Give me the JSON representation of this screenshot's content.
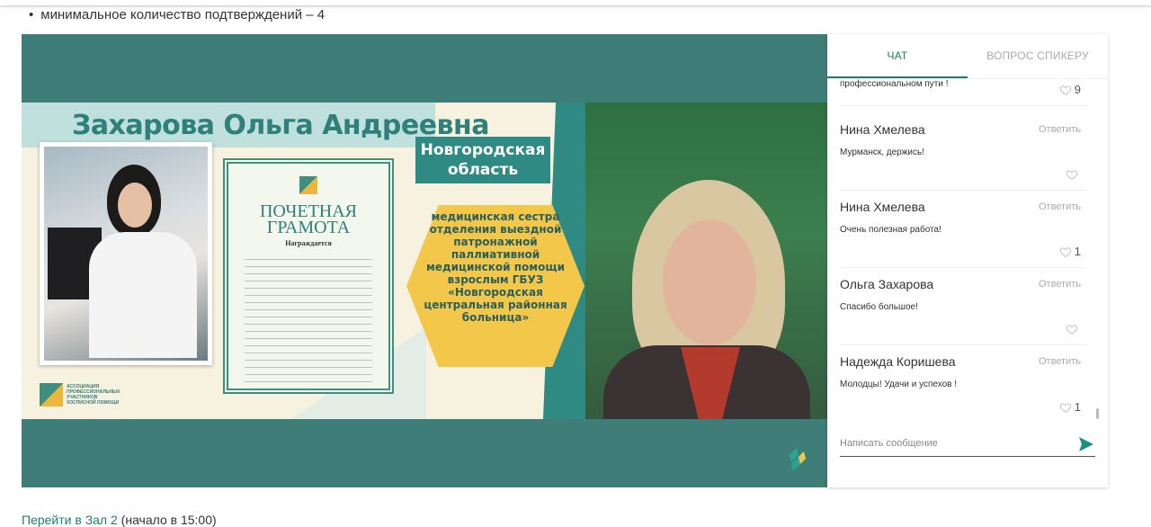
{
  "page": {
    "bullet_item": "минимальное количество подтверждений – 4",
    "bottom_link_text": "Перейти в Зал 2",
    "bottom_note": "(начало в 15:00)"
  },
  "slide": {
    "name": "Захарова Ольга Андреевна",
    "region_line1": "Новгородская",
    "region_line2": "область",
    "certificate_title_line1": "ПОЧЕТНАЯ",
    "certificate_title_line2": "ГРАМОТА",
    "certificate_subtitle": "Награждается",
    "position_text": "медицинская сестра отделения выездной патронажной паллиативной медицинской помощи взрослым ГБУЗ «Новгородская центральная районная больница»",
    "logo_text": "АССОЦИАЦИЯ ПРОФЕССИОНАЛЬНЫХ УЧАСТНИКОВ ХОСПИСНОЙ ПОМОЩИ"
  },
  "chat": {
    "tabs": [
      {
        "label": "ЧАТ",
        "active": true
      },
      {
        "label": "ВОПРОС СПИКЕРУ",
        "active": false
      }
    ],
    "reply_label": "Ответить",
    "messages": [
      {
        "author": "",
        "text": "профессиональном пути !",
        "likes": "9"
      },
      {
        "author": "Нина Хмелева",
        "text": "Мурманск, держись!",
        "likes": ""
      },
      {
        "author": "Нина Хмелева",
        "text": "Очень полезная работа!",
        "likes": "1"
      },
      {
        "author": "Ольга Захарова",
        "text": "Спасибо большое!",
        "likes": ""
      },
      {
        "author": "Надежда Коришева",
        "text": "Молодцы! Удачи и успехов !",
        "likes": "1"
      }
    ],
    "composer_placeholder": "Написать сообщение"
  },
  "colors": {
    "accent": "#1a7f6f",
    "player_bg": "#3e7d78",
    "send_icon": "#1a8f7f"
  }
}
